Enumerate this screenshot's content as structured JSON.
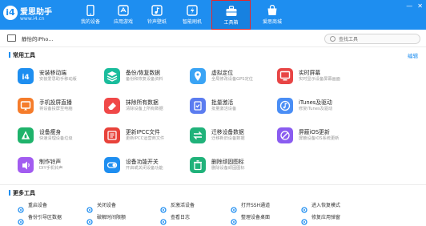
{
  "app": {
    "logo_name": "爱思助手",
    "logo_url": "www.i4.cn"
  },
  "nav": [
    {
      "label": "我的设备",
      "icon": "device-icon"
    },
    {
      "label": "应用游戏",
      "icon": "apps-icon"
    },
    {
      "label": "铃声壁纸",
      "icon": "music-icon"
    },
    {
      "label": "智能刷机",
      "icon": "flash-icon"
    },
    {
      "label": "工具箱",
      "icon": "toolbox-icon"
    },
    {
      "label": "爱思商城",
      "icon": "store-icon"
    }
  ],
  "device": {
    "name": "静怡的iPho..."
  },
  "search": {
    "placeholder": "查找工具"
  },
  "common_tools": {
    "heading": "常用工具",
    "edit_label": "编辑",
    "items": [
      {
        "title": "安装移动端",
        "desc": "安装爱思助手移动版",
        "color": "#1e8ef0",
        "icon": "i4-icon"
      },
      {
        "title": "备份/恢复数据",
        "desc": "备份和恢复设备资料",
        "color": "#1abc9c",
        "icon": "layers-icon"
      },
      {
        "title": "虚拟定位",
        "desc": "全局修改设备GPS定位",
        "color": "#3aa4f5",
        "icon": "location-icon"
      },
      {
        "title": "实时屏幕",
        "desc": "实时显示设备屏幕画面",
        "color": "#e84545",
        "icon": "screen-icon"
      },
      {
        "title": "手机投屏直播",
        "desc": "将设备投屏至电脑",
        "color": "#f57c2b",
        "icon": "cast-icon"
      },
      {
        "title": "抹除所有数据",
        "desc": "清除设备上所有数据",
        "color": "#f04848",
        "icon": "eraser-icon"
      },
      {
        "title": "批量激活",
        "desc": "批量激活设备",
        "color": "#5b7cf0",
        "icon": "activate-icon"
      },
      {
        "title": "iTunes及驱动",
        "desc": "修复iTunes及驱动",
        "color": "#4a8ef5",
        "icon": "itunes-icon"
      },
      {
        "title": "设备瘦身",
        "desc": "快速清理设备垃圾",
        "color": "#1fb36b",
        "icon": "clean-icon"
      },
      {
        "title": "更新IPCC文件",
        "desc": "更新IPCC运营商文件",
        "color": "#e8423a",
        "icon": "ipcc-icon"
      },
      {
        "title": "迁移设备数据",
        "desc": "迁移新旧设备数据",
        "color": "#20b27a",
        "icon": "migrate-icon"
      },
      {
        "title": "屏蔽iOS更新",
        "desc": "屏蔽设备iOS系统更新",
        "color": "#8a5cf0",
        "icon": "block-update-icon"
      },
      {
        "title": "制作铃声",
        "desc": "DIY手机铃声",
        "color": "#a25cf0",
        "icon": "ringtone-icon"
      },
      {
        "title": "设备功能开关",
        "desc": "开启或关闭设备功能",
        "color": "#1e8ef0",
        "icon": "switch-icon"
      },
      {
        "title": "删除顽固图标",
        "desc": "删除设备顽固图标",
        "color": "#20b27a",
        "icon": "delete-icon-icon"
      }
    ]
  },
  "more_tools": {
    "heading": "更多工具",
    "items": [
      {
        "label": "重启设备",
        "icon": "restart-icon",
        "color": "#1e8ef0"
      },
      {
        "label": "关闭设备",
        "icon": "power-icon",
        "color": "#1e8ef0"
      },
      {
        "label": "反激活设备",
        "icon": "deactivate-icon",
        "color": "#1e8ef0"
      },
      {
        "label": "打开SSH通道",
        "icon": "ssh-icon",
        "color": "#1e8ef0"
      },
      {
        "label": "进入恢复模式",
        "icon": "recovery-icon",
        "color": "#1e8ef0"
      },
      {
        "label": "备份引导区数据",
        "icon": "backup-icon",
        "color": "#1e8ef0"
      },
      {
        "label": "破解时间限额",
        "icon": "clock-icon",
        "color": "#1e8ef0"
      },
      {
        "label": "查看日志",
        "icon": "log-icon",
        "color": "#1e8ef0"
      },
      {
        "label": "整理设备桌面",
        "icon": "desktop-icon",
        "color": "#1e8ef0"
      },
      {
        "label": "修复应用弹窗",
        "icon": "fix-popup-icon",
        "color": "#1e8ef0"
      }
    ]
  }
}
